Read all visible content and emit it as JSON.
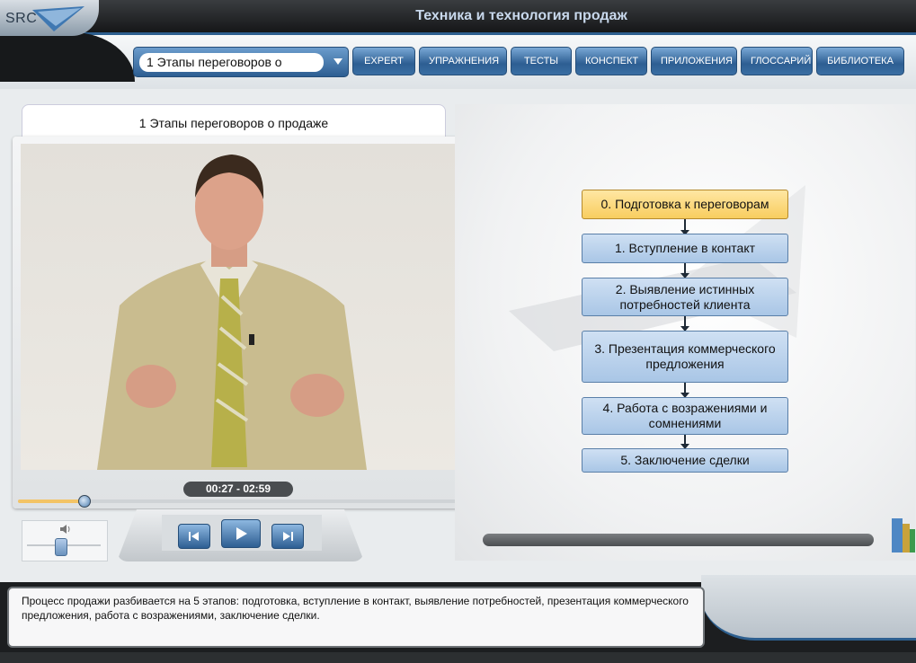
{
  "app": {
    "title": "Техника и технология продаж",
    "logo_text": "SRC"
  },
  "nav": {
    "lesson_select": "1 Этапы переговоров о",
    "buttons": [
      "EXPERT",
      "УПРАЖНЕНИЯ",
      "ТЕСТЫ",
      "КОНСПЕКТ",
      "ПРИЛОЖЕНИЯ",
      "ГЛОССАРИЙ",
      "БИБЛИОТЕКА"
    ]
  },
  "video": {
    "title": "1 Этапы переговоров о продаже",
    "time_display": "00:27 - 02:59",
    "progress": 0.15,
    "volume": 0.45
  },
  "flow": {
    "steps": [
      {
        "label": "0. Подготовка к переговорам",
        "active": true
      },
      {
        "label": "1. Вступление в контакт",
        "active": false
      },
      {
        "label": "2. Выявление истинных потребностей клиента",
        "active": false
      },
      {
        "label": "3. Презентация коммерческого предложения",
        "active": false
      },
      {
        "label": "4. Работа с возражениями и сомнениями",
        "active": false
      },
      {
        "label": "5. Заключение сделки",
        "active": false
      }
    ]
  },
  "description": "Процесс продажи разбивается на 5 этапов: подготовка, вступление в контакт, выявление потребностей, презентация коммерческого предложения, работа с возражениями, заключение сделки.",
  "colors": {
    "accent": "#2d5e92",
    "active_step": "#f8cd5f",
    "step": "#a9c6e6",
    "progress": "#f3c466"
  }
}
